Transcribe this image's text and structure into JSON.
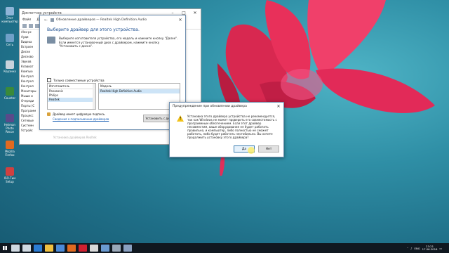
{
  "desktop_icons": [
    {
      "name": "computer-icon",
      "label": "Этот компьютер",
      "color": "#8fb5d8"
    },
    {
      "name": "network-icon",
      "label": "Сеть",
      "color": "#6fa0c8"
    },
    {
      "name": "recycle-bin-icon",
      "label": "Корзина",
      "color": "#c8d2dc"
    },
    {
      "name": "counter-icon",
      "label": "Counter",
      "color": "#3a8a3a"
    },
    {
      "name": "program-icon",
      "label": "Hetman Photo Recov",
      "color": "#5a4a8a"
    },
    {
      "name": "firefox-icon",
      "label": "Mozilla Firefox",
      "color": "#e06a20"
    },
    {
      "name": "iso-icon",
      "label": "ISO-Тим Setup",
      "color": "#d04040"
    }
  ],
  "device_manager": {
    "title": "Диспетчер устройств",
    "menu": [
      "Файл",
      "Действие",
      "Вид",
      "Справка"
    ],
    "tree": [
      "Alex-pc",
      "Ауди",
      "Видеоа",
      "Встроен",
      "Диски",
      "Дисково",
      "Звуков",
      "Клавиат",
      "Компью",
      "Контрол",
      "Контрол",
      "Контрол",
      "Мониторы",
      "Мыши и",
      "Очереди",
      "Порты (С",
      "Программ",
      "Процесс",
      "Сетевые",
      "Системн",
      "Устройс"
    ],
    "dim_text": "Установка драйверов Realtek"
  },
  "wizard": {
    "title": "Обновление драйверов — Realtek High Definition Audio",
    "heading": "Выберите драйвер для этого устройства.",
    "description": "Выберите изготовителя устройства, его модель и нажмите кнопку \"Далее\". Если имеется установочный диск с драйвером, нажмите кнопку \"Установить с диска\".",
    "compatible_label": "Только совместимые устройства",
    "col_manufacturer": "Изготовитель",
    "col_model": "Модель",
    "manufacturers": [
      "Panasonic",
      "Philips",
      "Realtek"
    ],
    "models": [
      "Realtek High Definition Audio"
    ],
    "signed_text": "Драйвер имеет цифровую подпись.",
    "signing_link": "Сведения о подписывании драйверов",
    "have_disk_button": "Установить с диска..."
  },
  "warning_dialog": {
    "title": "Предупреждение при обновлении драйвера",
    "message": "Установка этого драйвера устройства не рекомендуется, так как Windows не может проверить его совместимость с программным обеспечением. Если этот драйвер несовместим, ваше оборудование не будет работать правильно, и компьютер, либо полностью не сможет работать, либо будет работать нестабильно. Вы хотите продолжить установку этого драйвера?",
    "yes_button": "Да",
    "no_button": "Нет"
  },
  "taskbar": {
    "apps": [
      {
        "name": "search-icon",
        "color": "#cfd8e0"
      },
      {
        "name": "task-view-icon",
        "color": "#cfd8e0"
      },
      {
        "name": "edge-icon",
        "color": "#2b7cd3"
      },
      {
        "name": "explorer-icon",
        "color": "#f0c040"
      },
      {
        "name": "store-icon",
        "color": "#4a8ad8"
      },
      {
        "name": "firefox-taskbar-icon",
        "color": "#e06a20"
      },
      {
        "name": "opera-icon",
        "color": "#d02030"
      },
      {
        "name": "media-icon",
        "color": "#d8d8d8"
      },
      {
        "name": "photo-icon",
        "color": "#6a9ad0"
      },
      {
        "name": "settings-app-icon",
        "color": "#9aa8b8"
      },
      {
        "name": "device-app-icon",
        "color": "#8aa0c0"
      }
    ],
    "lang": "ENG",
    "time": "23:21",
    "date": "17.06.2016"
  }
}
